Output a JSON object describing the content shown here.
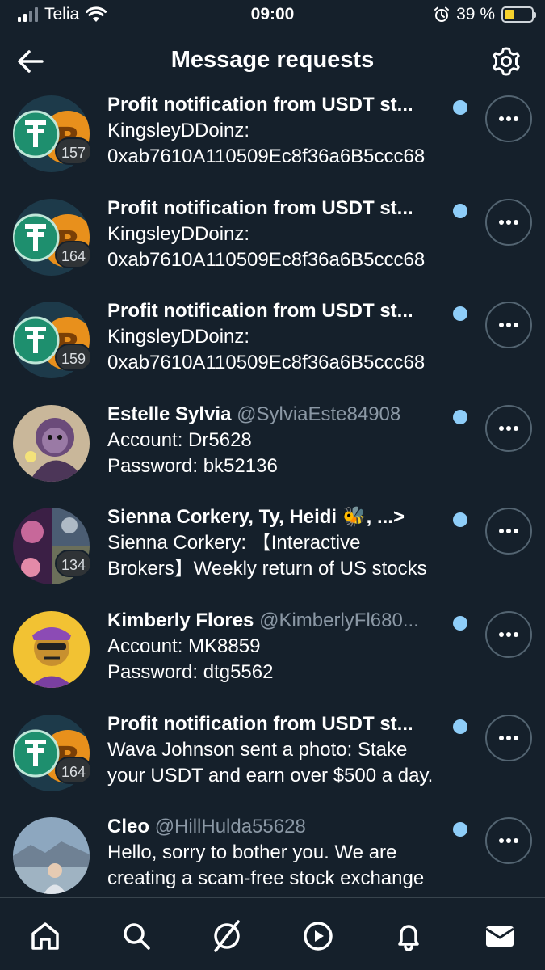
{
  "status_bar": {
    "carrier": "Telia",
    "time": "09:00",
    "battery_percent": "39 %",
    "battery_level": 0.39,
    "icons": [
      "signal-icon",
      "wifi-icon",
      "alarm-icon",
      "battery-icon"
    ]
  },
  "header": {
    "title": "Message requests",
    "back_icon": "arrow-left-icon",
    "settings_icon": "gear-icon"
  },
  "colors": {
    "background": "#15202b",
    "unread_dot": "#8ecdf8",
    "handle_gray": "#8b98a5",
    "divider": "#38444d"
  },
  "conversations": [
    {
      "avatar": "tether-bitcoin-avatar",
      "badge": "157",
      "name": "Profit notification from USDT st...",
      "handle": "",
      "lines": [
        "KingsleyDDoinz:",
        "0xab7610A110509Ec8f36a6B5ccc68"
      ],
      "unread": true
    },
    {
      "avatar": "tether-bitcoin-avatar",
      "badge": "164",
      "name": "Profit notification from USDT st...",
      "handle": "",
      "lines": [
        "KingsleyDDoinz:",
        "0xab7610A110509Ec8f36a6B5ccc68"
      ],
      "unread": true
    },
    {
      "avatar": "tether-bitcoin-avatar",
      "badge": "159",
      "name": "Profit notification from USDT st...",
      "handle": "",
      "lines": [
        "KingsleyDDoinz:",
        "0xab7610A110509Ec8f36a6B5ccc68"
      ],
      "unread": true
    },
    {
      "avatar": "monkey-art-avatar",
      "badge": "",
      "name": "Estelle Sylvia",
      "handle": "@SylviaEste84908",
      "lines": [
        "Account: Dr5628",
        "Password: bk52136"
      ],
      "unread": true
    },
    {
      "avatar": "group-photo-avatar",
      "badge": "134",
      "name": "Sienna Corkery, Ty, Heidi 🐝, ...>",
      "handle": "",
      "lines": [
        "Sienna Corkery: 【Interactive",
        "Brokers】Weekly return of US stocks"
      ],
      "unread": true
    },
    {
      "avatar": "ape-nft-avatar",
      "badge": "",
      "name": "Kimberly Flores",
      "handle": "@KimberlyFl680...",
      "lines": [
        "Account: MK8859",
        "Password: dtg5562"
      ],
      "unread": true
    },
    {
      "avatar": "tether-bitcoin-avatar",
      "badge": "164",
      "name": "Profit notification from USDT st...",
      "handle": "",
      "lines": [
        "Wava Johnson sent a photo: Stake",
        "your USDT and earn over $500 a day."
      ],
      "unread": true
    },
    {
      "avatar": "landscape-photo-avatar",
      "badge": "",
      "name": "Cleo",
      "handle": "@HillHulda55628",
      "lines": [
        "Hello, sorry to bother you. We are",
        "creating a scam-free stock exchange"
      ],
      "unread": true
    }
  ],
  "bottom_nav": [
    "home-icon",
    "search-icon",
    "communities-icon",
    "video-icon",
    "notifications-icon",
    "messages-icon"
  ]
}
